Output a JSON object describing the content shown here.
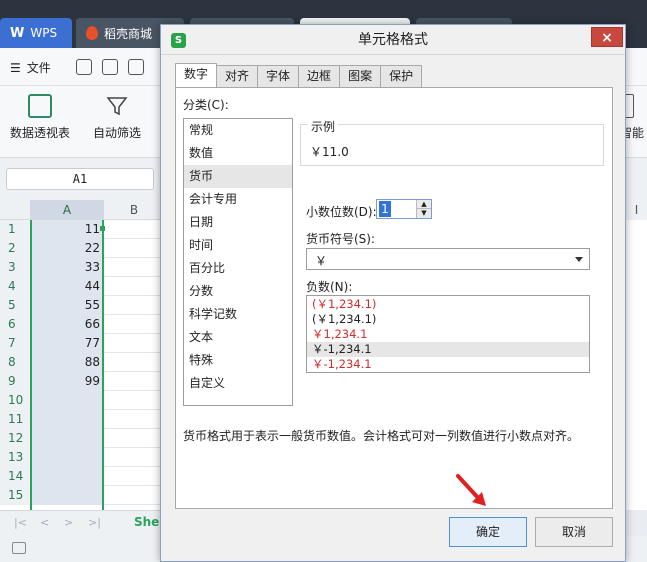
{
  "app": {
    "tabs": [
      {
        "label": "WPS",
        "logo": "W"
      },
      {
        "label": "稻壳商城"
      }
    ]
  },
  "menubar": {
    "file_label": "文件"
  },
  "ribbon": {
    "pivot_label": "数据透视表",
    "filter_label": "自动筛选",
    "smart_label": "智能"
  },
  "sheet": {
    "name_box": "A1",
    "columns": [
      "A",
      "B"
    ],
    "right_column": "I",
    "rows": [
      {
        "num": "1",
        "a": "11"
      },
      {
        "num": "2",
        "a": "22"
      },
      {
        "num": "3",
        "a": "33"
      },
      {
        "num": "4",
        "a": "44"
      },
      {
        "num": "5",
        "a": "55"
      },
      {
        "num": "6",
        "a": "66"
      },
      {
        "num": "7",
        "a": "77"
      },
      {
        "num": "8",
        "a": "88"
      },
      {
        "num": "9",
        "a": "99"
      },
      {
        "num": "10",
        "a": ""
      },
      {
        "num": "11",
        "a": ""
      },
      {
        "num": "12",
        "a": ""
      },
      {
        "num": "13",
        "a": ""
      },
      {
        "num": "14",
        "a": ""
      },
      {
        "num": "15",
        "a": ""
      }
    ],
    "sheet_tab": "Shee"
  },
  "dialog": {
    "title": "单元格格式",
    "logo": "S",
    "close": "×",
    "tabs": [
      "数字",
      "对齐",
      "字体",
      "边框",
      "图案",
      "保护"
    ],
    "category_label": "分类(C):",
    "categories": [
      "常规",
      "数值",
      "货币",
      "会计专用",
      "日期",
      "时间",
      "百分比",
      "分数",
      "科学记数",
      "文本",
      "特殊",
      "自定义"
    ],
    "selected_category": "货币",
    "sample_legend": "示例",
    "sample_value": "￥11.0",
    "decimals_label": "小数位数(D):",
    "decimals_value": "1",
    "symbol_label": "货币符号(S):",
    "symbol_value": "￥",
    "negative_label": "负数(N):",
    "negative_options": [
      {
        "text": "(￥1,234.1)",
        "red": true
      },
      {
        "text": "(￥1,234.1)",
        "red": false
      },
      {
        "text": "￥1,234.1",
        "red": true
      },
      {
        "text": "￥-1,234.1",
        "red": false
      },
      {
        "text": "￥-1,234.1",
        "red": true
      }
    ],
    "description": "货币格式用于表示一般货币数值。会计格式可对一列数值进行小数点对齐。",
    "ok_label": "确定",
    "cancel_label": "取消"
  },
  "colors": {
    "accent_green": "#2ca35d",
    "wps_blue": "#3b6fd1",
    "negative_red": "#d22a2a",
    "arrow_red": "#e02020"
  }
}
